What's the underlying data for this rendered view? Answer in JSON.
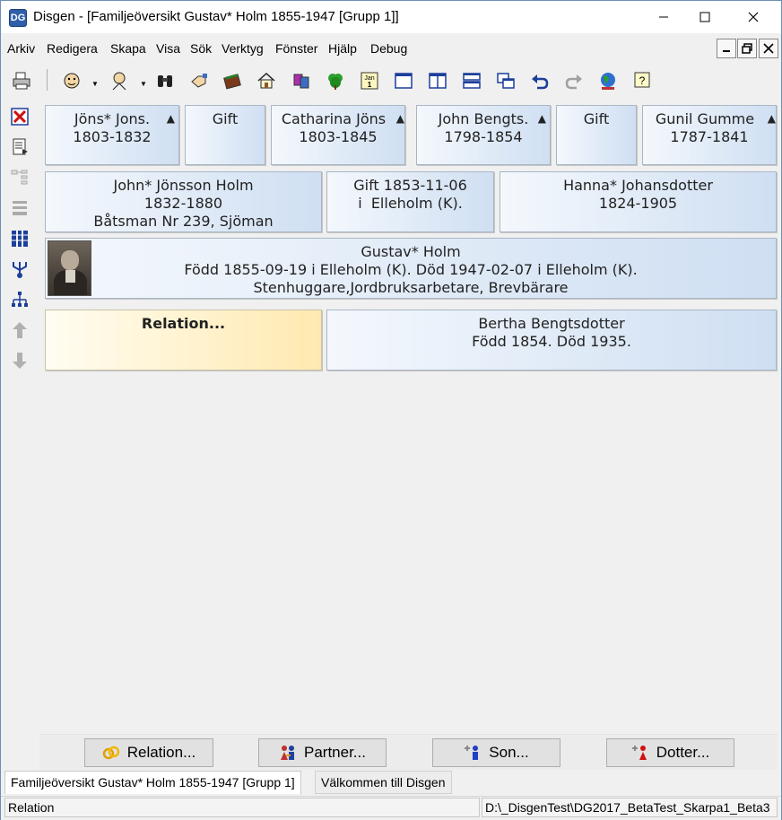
{
  "window": {
    "app_name": "Disgen - [Familjeöversikt Gustav* Holm 1855-1947 [Grupp 1]]",
    "icon_text": "DG"
  },
  "menu": [
    "Arkiv",
    "Redigera",
    "Skapa",
    "Visa",
    "Sök",
    "Verktyg",
    "Fönster",
    "Hjälp",
    "Debug"
  ],
  "toolbar_icons": [
    "printer-icon",
    "person-icon",
    "person-search-icon",
    "binoculars-icon",
    "hand-icon",
    "book-icon",
    "home-icon",
    "people-icon",
    "tree-icon",
    "calendar-icon",
    "window-icon",
    "split-window-icon",
    "tile-horizontal-icon",
    "cascade-icon",
    "undo-icon",
    "redo-icon",
    "globe-icon",
    "help-icon"
  ],
  "calendar_icon_text": {
    "month": "Jan",
    "day": "1"
  },
  "grandparents": [
    {
      "name": "Jöns* Jons.",
      "years": "1803-1832",
      "marker": "▲"
    },
    {
      "label": "Gift"
    },
    {
      "name": "Catharina Jöns",
      "years": "1803-1845",
      "marker": "▲"
    },
    {
      "name": "John Bengts.",
      "years": "1798-1854",
      "marker": "▲"
    },
    {
      "label": "Gift"
    },
    {
      "name": "Gunil Gumme",
      "years": "1787-1841",
      "marker": "▲"
    }
  ],
  "parents": {
    "father": {
      "name": "John* Jönsson Holm",
      "years": "1832-1880",
      "occupation": "Båtsman Nr 239, Sjöman"
    },
    "marriage": {
      "line1": "Gift 1853-11-06",
      "line2": "i  Elleholm (K)."
    },
    "mother": {
      "name": "Hanna* Johansdotter",
      "years": "1824-1905"
    }
  },
  "main_person": {
    "name": "Gustav* Holm",
    "life": "Född 1855-09-19 i Elleholm (K). Död 1947-02-07 i Elleholm (K).",
    "occupation": "Stenhuggare,Jordbruksarbetare, Brevbärare"
  },
  "relation_card": {
    "label": "Relation..."
  },
  "spouse": {
    "name": "Bertha Bengtsdotter",
    "life": "Född 1854. Död 1935."
  },
  "buttons": {
    "relation": "Relation...",
    "partner": "Partner...",
    "son": "Son...",
    "daughter": "Dotter..."
  },
  "tabs": {
    "active": "Familjeöversikt Gustav* Holm 1855-1947 [Grupp 1]",
    "inactive": "Välkommen till Disgen"
  },
  "status": {
    "left": "Relation",
    "right": "D:\\_DisgenTest\\DG2017_BetaTest_Skarpa1_Beta3"
  }
}
